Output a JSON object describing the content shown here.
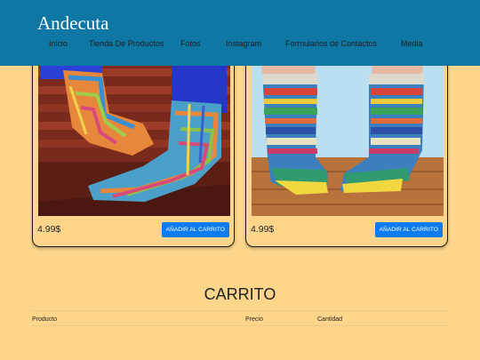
{
  "header": {
    "brand": "Andecuta",
    "nav": [
      "Inicio",
      "Tienda De Productos",
      "Fotos",
      "Instagram",
      "Formularios de Contactos",
      "Media"
    ]
  },
  "products": [
    {
      "price": "4.99$",
      "button": "AÑADIR AL CARRITO"
    },
    {
      "price": "4.99$",
      "button": "AÑADIR AL CARRITO"
    }
  ],
  "cart": {
    "title": "CARRITO",
    "columns": [
      "Producto",
      "Precio",
      "Cantidad"
    ]
  },
  "colors": {
    "header_bg": "#0e77a3",
    "page_bg": "#fdd68b",
    "button_bg": "#0d7bf0"
  }
}
